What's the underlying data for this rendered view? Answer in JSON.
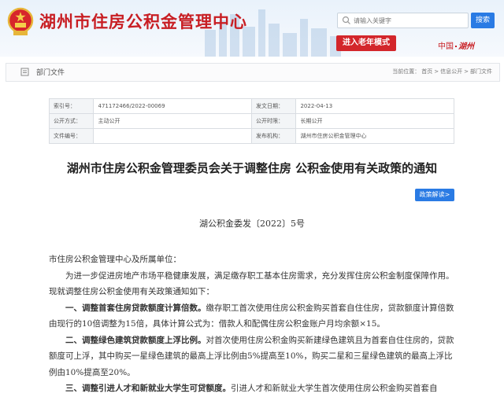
{
  "header": {
    "site_title": "湖州市住房公积金管理中心",
    "search_placeholder": "请输入关键字",
    "search_button": "搜索",
    "elder_mode_button": "进入老年模式",
    "brand_logo_left": "中国",
    "brand_logo_right": "湖州"
  },
  "nav": {
    "section_title": "部门文件",
    "breadcrumb": [
      "当前位置：",
      "首页",
      ">",
      "信息公开",
      ">",
      "部门文件"
    ]
  },
  "meta": {
    "rows": [
      {
        "k1": "索引号：",
        "v1": "471172466/2022-00069",
        "k2": "发文日期：",
        "v2": "2022-04-13"
      },
      {
        "k1": "公开方式：",
        "v1": "主动公开",
        "k2": "公开时限：",
        "v2": "长期公开"
      },
      {
        "k1": "文件编号：",
        "v1": "",
        "k2": "发布机构：",
        "v2": "湖州市住房公积金管理中心"
      }
    ]
  },
  "article": {
    "title": "湖州市住房公积金管理委员会关于调整住房 公积金使用有关政策的通知",
    "interpretation_button": "政策解读>",
    "doc_number": "湖公积金委发〔2022〕5号",
    "salutation": "市住房公积金管理中心及所属单位：",
    "intro": "为进一步促进房地产市场平稳健康发展，满足缴存职工基本住房需求，充分发挥住房公积金制度保障作用。现就调整住房公积金使用有关政策通知如下：",
    "item1_heading": "一、调整首套住房贷款额度计算倍数。",
    "item1_body": "缴存职工首次使用住房公积金购买首套自住住房，贷款额度计算倍数由现行的10倍调整为15倍，具体计算公式为：借款人和配偶住房公积金账户月均余额×15。",
    "item2_heading": "二、调整绿色建筑贷款额度上浮比例。",
    "item2_body": "对首次使用住房公积金购买新建绿色建筑且为首套自住住房的，贷款额度可上浮，其中购买一星绿色建筑的最高上浮比例由5%提高至10%，购买二星和三星绿色建筑的最高上浮比例由10%提高至20%。",
    "item3_heading": "三、调整引进人才和新就业大学生可贷额度。",
    "item3_body": "引进人才和新就业大学生首次使用住房公积金购买首套自"
  },
  "colors": {
    "brand_red": "#c81e23",
    "accent_blue": "#2a7be4"
  }
}
